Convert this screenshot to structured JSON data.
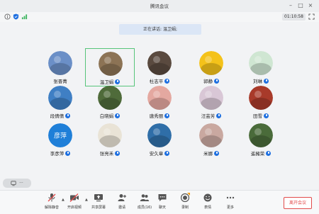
{
  "window": {
    "title": "腾讯会议"
  },
  "topbar": {
    "timer": "01:10:58"
  },
  "speaking_banner": "正在讲话: 温卫娟;",
  "participants": [
    {
      "name": "张晋菁",
      "mic": false,
      "active": false,
      "color": "#6b8fc7"
    },
    {
      "name": "温卫娟",
      "mic": true,
      "active": true,
      "color": "#8c7355"
    },
    {
      "name": "杜志平",
      "mic": true,
      "active": false,
      "color": "#5a4a3f"
    },
    {
      "name": "郭静",
      "mic": true,
      "active": false,
      "color": "#f4c21a"
    },
    {
      "name": "刘琳",
      "mic": true,
      "active": false,
      "color": "#cfe6d2"
    },
    {
      "name": "段倩倩",
      "mic": true,
      "active": false,
      "color": "#3f7fc4"
    },
    {
      "name": "白晓娟",
      "mic": true,
      "active": false,
      "color": "#4f6b3a"
    },
    {
      "name": "唐秀丽",
      "mic": true,
      "active": false,
      "color": "#e4a8a0"
    },
    {
      "name": "汪芸芳",
      "mic": true,
      "active": false,
      "color": "#d9c7d6"
    },
    {
      "name": "田雪",
      "mic": true,
      "active": false,
      "color": "#a83a2a"
    },
    {
      "name": "李彦萍",
      "mic": true,
      "active": false,
      "color": "#1f7fd8",
      "initials": "彦萍"
    },
    {
      "name": "张亮禾",
      "mic": true,
      "active": false,
      "color": "#e9e3d6"
    },
    {
      "name": "安久章",
      "mic": true,
      "active": false,
      "color": "#2f6ea8"
    },
    {
      "name": "米娜",
      "mic": true,
      "active": false,
      "color": "#c9a8a0"
    },
    {
      "name": "遥擁荣",
      "mic": true,
      "active": false,
      "color": "#4a6b3a"
    }
  ],
  "tag_label": "",
  "toolbar": {
    "mute": "解除静音",
    "video": "开启视频",
    "share": "共享屏幕",
    "invite": "邀请",
    "members": "成员(16)",
    "chat": "聊天",
    "record": "录制",
    "reactions": "表情",
    "more": "更多",
    "leave": "离开会议"
  },
  "colors": {
    "accent": "#1e6fe0",
    "leave": "#e24b4b",
    "active_border": "#57c47a"
  }
}
